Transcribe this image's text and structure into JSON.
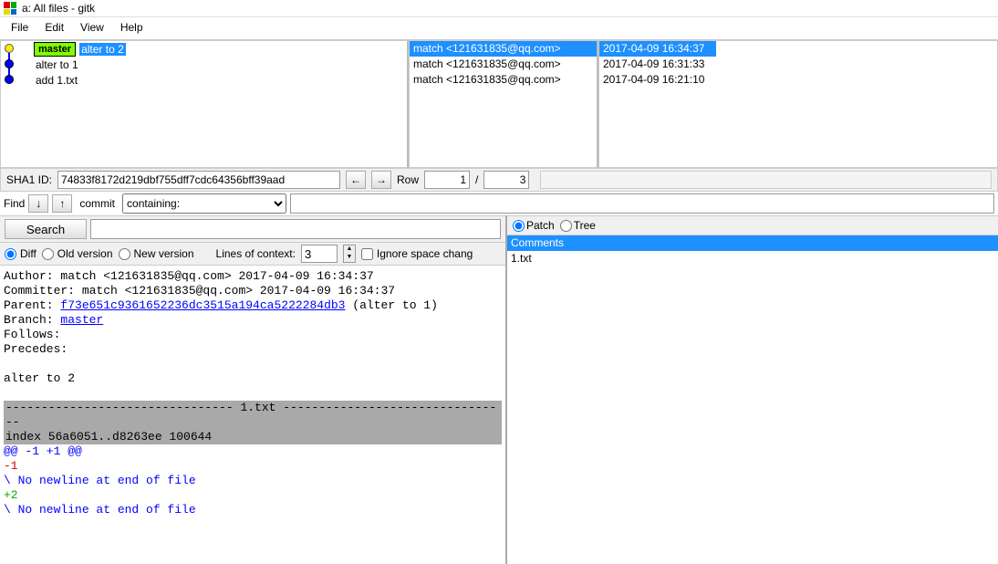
{
  "window": {
    "title": "a: All files - gitk"
  },
  "menu": {
    "file": "File",
    "edit": "Edit",
    "view": "View",
    "help": "Help"
  },
  "commits": [
    {
      "ref": "master",
      "msg": "alter to 2",
      "author": "match <121631835@qq.com>",
      "date": "2017-04-09 16:34:37",
      "selected": true,
      "node": "yellow"
    },
    {
      "ref": "",
      "msg": "alter to 1",
      "author": "match <121631835@qq.com>",
      "date": "2017-04-09 16:31:33",
      "selected": false,
      "node": "blue"
    },
    {
      "ref": "",
      "msg": "add 1.txt",
      "author": "match <121631835@qq.com>",
      "date": "2017-04-09 16:21:10",
      "selected": false,
      "node": "blue"
    }
  ],
  "nav": {
    "sha_label": "SHA1 ID:",
    "sha": "74833f8172d219dbf755dff7cdc64356bff39aad",
    "row_label": "Row",
    "row": "1",
    "slash": "/",
    "total": "3"
  },
  "find": {
    "label": "Find",
    "scope": "commit",
    "mode": "containing:",
    "value": ""
  },
  "search": {
    "button": "Search",
    "value": ""
  },
  "diffopts": {
    "diff": "Diff",
    "old": "Old version",
    "new": "New version",
    "lines_label": "Lines of context:",
    "lines": "3",
    "ignore": "Ignore space chang"
  },
  "patchopts": {
    "patch": "Patch",
    "tree": "Tree"
  },
  "filelist": {
    "header": "Comments",
    "items": [
      "1.txt"
    ]
  },
  "diff": {
    "author_line": "Author: match <121631835@qq.com>  2017-04-09 16:34:37",
    "committer_line": "Committer: match <121631835@qq.com>  2017-04-09 16:34:37",
    "parent_label": "Parent: ",
    "parent_sha": "f73e651c9361652236dc3515a194ca5222284db3",
    "parent_desc": " (alter to 1)",
    "branch_label": "Branch: ",
    "branch": "master",
    "follows": "Follows:",
    "precedes": "Precedes:",
    "msg": "    alter to 2",
    "filehdr": "-------------------------------- 1.txt --------------------------------",
    "indexline": "index 56a6051..d8263ee 100644",
    "hunk": "@@ -1 +1 @@",
    "del": "-1",
    "noeol1": "\\ No newline at end of file",
    "add": "+2",
    "noeol2": "\\ No newline at end of file"
  }
}
